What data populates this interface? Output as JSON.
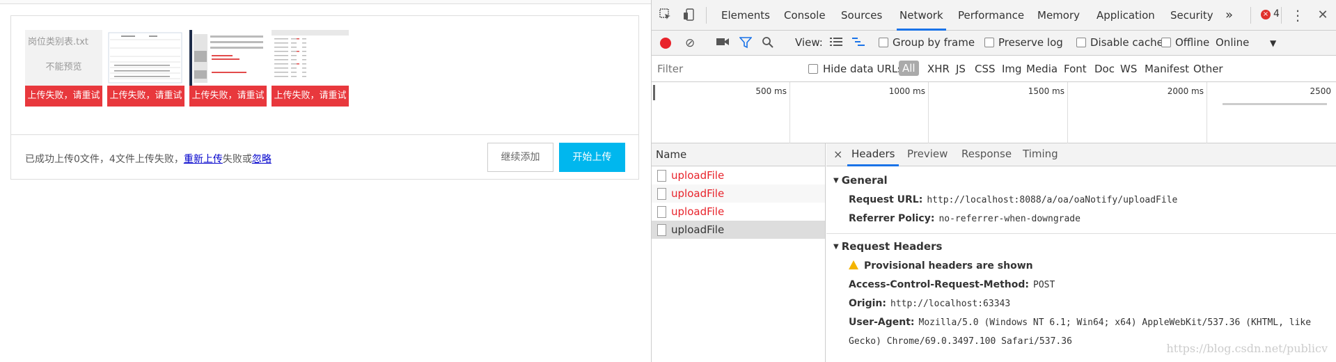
{
  "uploader": {
    "items": [
      {
        "name": "岗位类别表.txt",
        "no_preview": "不能预览",
        "error": "上传失败，请重试"
      },
      {
        "error": "上传失败，请重试"
      },
      {
        "error": "上传失败，请重试"
      },
      {
        "error": "上传失败，请重试"
      }
    ],
    "status_text": "已成功上传0文件，4文件上传失败，",
    "retry_link": "重新上传",
    "status_mid": "失败或",
    "ignore_link": "忽略",
    "add_button": "继续添加",
    "start_button": "开始上传",
    "colors": {
      "error": "#e8383d",
      "primary": "#00b7ee"
    }
  },
  "devtools": {
    "tabs": [
      "Elements",
      "Console",
      "Sources",
      "Network",
      "Performance",
      "Memory",
      "Application",
      "Security"
    ],
    "active_tab": "Network",
    "more": "»",
    "error_count": "4",
    "toolbar": {
      "view_label": "View:",
      "group_by_frame": "Group by frame",
      "preserve_log": "Preserve log",
      "disable_cache": "Disable cache",
      "offline": "Offline",
      "throttle": "Online"
    },
    "filter": {
      "placeholder": "Filter",
      "hide_data_urls": "Hide data URLs",
      "types": [
        "All",
        "XHR",
        "JS",
        "CSS",
        "Img",
        "Media",
        "Font",
        "Doc",
        "WS",
        "Manifest",
        "Other"
      ]
    },
    "timeline_labels": [
      "500 ms",
      "1000 ms",
      "1500 ms",
      "2000 ms",
      "2500"
    ],
    "requests": {
      "header": "Name",
      "items": [
        "uploadFile",
        "uploadFile",
        "uploadFile",
        "uploadFile"
      ]
    },
    "details": {
      "close": "×",
      "tabs": [
        "Headers",
        "Preview",
        "Response",
        "Timing"
      ],
      "active_tab": "Headers",
      "general_title": "General",
      "request_url_label": "Request URL:",
      "request_url": "http://localhost:8088/a/oa/oaNotify/uploadFile",
      "referrer_label": "Referrer Policy:",
      "referrer": "no-referrer-when-downgrade",
      "req_headers_title": "Request Headers",
      "provisional": "Provisional headers are shown",
      "acrm_label": "Access-Control-Request-Method:",
      "acrm": "POST",
      "origin_label": "Origin:",
      "origin": "http://localhost:63343",
      "ua_label": "User-Agent:",
      "ua_line1": "Mozilla/5.0 (Windows NT 6.1; Win64; x64) AppleWebKit/537.36 (KHTML, like",
      "ua_line2": "Gecko) Chrome/69.0.3497.100 Safari/537.36"
    },
    "watermark": "https://blog.csdn.net/publicv"
  }
}
